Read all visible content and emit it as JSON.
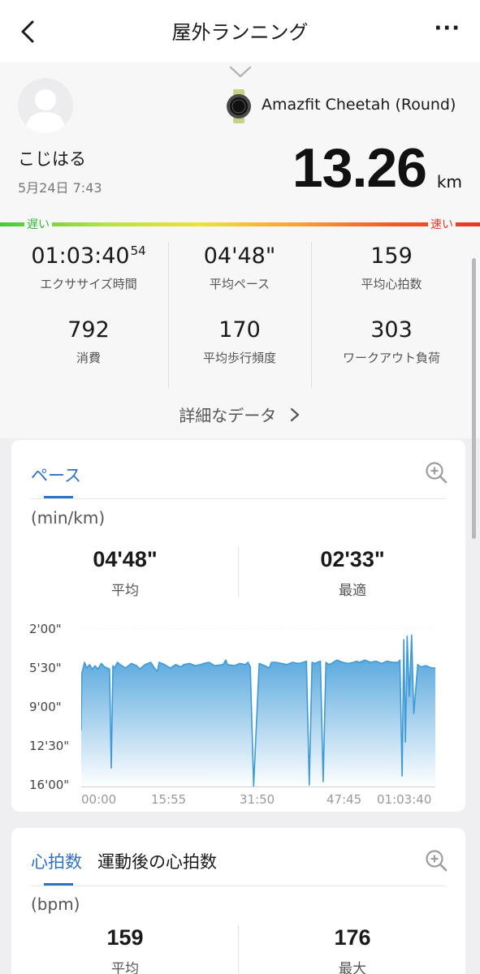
{
  "header": {
    "title": "屋外ランニング",
    "back_icon": "chevron-left-icon",
    "more_label": "···"
  },
  "profile": {
    "name": "こじはる",
    "datetime": "5月24日 7:43"
  },
  "device": {
    "name": "Amazfit Cheetah (Round)",
    "icon": "watch-icon"
  },
  "distance": {
    "value": "13.26",
    "unit": "km"
  },
  "speed_bar": {
    "slow_label": "遅い",
    "fast_label": "速い",
    "colors": [
      "#47c941",
      "#f2df3b",
      "#e2392b"
    ]
  },
  "stats": [
    {
      "value": "01:03:40",
      "sup": "54",
      "label": "エクササイズ時間"
    },
    {
      "value": "04'48\"",
      "sup": "",
      "label": "平均ペース"
    },
    {
      "value": "159",
      "sup": "",
      "label": "平均心拍数"
    },
    {
      "value": "792",
      "sup": "",
      "label": "消費"
    },
    {
      "value": "170",
      "sup": "",
      "label": "平均歩行頻度"
    },
    {
      "value": "303",
      "sup": "",
      "label": "ワークアウト負荷"
    }
  ],
  "detail_link": "詳細なデータ",
  "pace_card": {
    "tab": "ペース",
    "unit": "(min/km)",
    "avg_value": "04'48\"",
    "avg_label": "平均",
    "best_value": "02'33\"",
    "best_label": "最適",
    "accent": "#2f72c4"
  },
  "chart_data": {
    "type": "area",
    "title": "ペース",
    "ylabel": "(min/km)",
    "y_tick_labels": [
      "2'00\"",
      "5'30\"",
      "9'00\"",
      "12'30\"",
      "16'00\""
    ],
    "y_ticks_min": [
      2,
      5.5,
      9,
      12.5,
      16
    ],
    "x_tick_labels": [
      "00:00",
      "15:55",
      "31:50",
      "47:45",
      "01:03:40"
    ],
    "x_ticks_min": [
      0,
      15.92,
      31.83,
      47.75,
      63.67
    ],
    "ylim_min_per_km": [
      2,
      16
    ],
    "y_inverted": true,
    "color": "#3e9ad8",
    "series": [
      {
        "x_min": [
          0,
          0.1,
          0.3,
          0.6,
          1.0,
          1.5,
          2.0,
          2.5,
          3.0,
          3.6,
          4.2,
          5.1,
          5.4,
          5.7,
          6.0,
          6.5,
          7.0,
          8.0,
          9.0,
          10.0,
          10.5,
          11.5,
          12.5,
          13.3,
          13.7,
          14.0,
          15.0,
          16.0,
          17.0,
          17.5,
          18.0,
          18.4,
          19.5,
          20.5,
          21.5,
          22.0,
          23.0,
          24.0,
          25.5,
          26.0,
          26.3,
          27.5,
          28.5,
          29.5,
          30.0,
          30.4,
          31.0,
          32.0,
          33.0,
          33.8,
          34.2,
          35.0,
          36.0,
          37.0,
          38.0,
          39.0,
          40.0,
          40.5,
          41.0,
          41.5,
          42.0,
          42.5,
          43.0,
          43.5,
          44.0,
          44.5,
          45.0,
          46.0,
          47.0,
          48.0,
          49.0,
          49.5,
          50.0,
          51.0,
          52.0,
          53.0,
          54.0,
          55.0,
          56.0,
          57.0,
          57.3,
          57.7,
          58.0,
          58.3,
          58.6,
          59.0,
          59.4,
          59.8,
          60.5,
          61.0,
          62.0,
          63.0,
          63.67
        ],
        "pace_min": [
          11.0,
          6.0,
          5.6,
          5.0,
          5.5,
          5.2,
          5.6,
          5.3,
          5.6,
          5.1,
          5.4,
          5.6,
          14.3,
          5.3,
          5.5,
          5.0,
          5.2,
          5.5,
          5.1,
          5.3,
          5.6,
          5.2,
          5.0,
          5.6,
          5.8,
          5.0,
          5.2,
          5.5,
          5.2,
          5.3,
          5.4,
          5.2,
          5.1,
          5.3,
          5.2,
          5.1,
          5.0,
          5.3,
          5.2,
          4.8,
          5.2,
          5.3,
          5.1,
          5.2,
          5.0,
          5.4,
          15.9,
          5.1,
          5.3,
          5.5,
          5.0,
          5.0,
          5.1,
          5.2,
          5.0,
          5.1,
          5.0,
          4.9,
          15.8,
          5.0,
          5.1,
          5.0,
          4.9,
          15.5,
          5.0,
          5.2,
          5.1,
          4.8,
          5.0,
          5.1,
          5.0,
          4.9,
          5.0,
          4.8,
          5.0,
          4.9,
          5.1,
          4.9,
          5.0,
          5.0,
          4.8,
          15.0,
          3.0,
          12.0,
          2.7,
          8.0,
          2.6,
          9.5,
          5.2,
          5.4,
          5.3,
          5.5,
          5.5
        ]
      }
    ]
  },
  "hr_card": {
    "tab_active": "心拍数",
    "tab_2": "運動後の心拍数",
    "unit": "(bpm)",
    "avg_value": "159",
    "avg_label": "平均",
    "max_value": "176",
    "max_label": "最大"
  }
}
